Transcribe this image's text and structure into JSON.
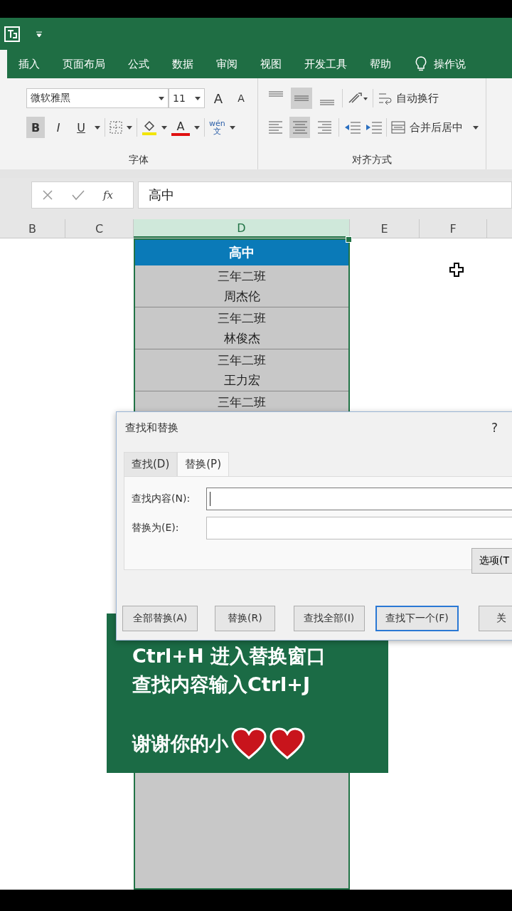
{
  "ribbon_tabs": [
    {
      "label": "插入",
      "selected": false
    },
    {
      "label": "页面布局",
      "selected": false
    },
    {
      "label": "公式",
      "selected": false
    },
    {
      "label": "数据",
      "selected": false
    },
    {
      "label": "审阅",
      "selected": false
    },
    {
      "label": "视图",
      "selected": false
    },
    {
      "label": "开发工具",
      "selected": false
    },
    {
      "label": "帮助",
      "selected": false
    }
  ],
  "tell_me": "操作说",
  "font_group": {
    "font_name": "微软雅黑",
    "font_size": "11",
    "grow_font": "A",
    "shrink_font": "A",
    "style_buttons": [
      {
        "label": "B",
        "selected": true
      },
      {
        "label": "I",
        "selected": false
      },
      {
        "label": "U",
        "selected": false
      }
    ],
    "font_color": "A",
    "phonetic": "wén",
    "phonetic_char": "文",
    "label": "字体"
  },
  "alignment_group": {
    "align_buttons": [
      {
        "kind": "top",
        "selected": false
      },
      {
        "kind": "middle",
        "selected": true
      },
      {
        "kind": "bottom",
        "selected": false
      },
      {
        "kind": "left",
        "selected": false
      },
      {
        "kind": "center",
        "selected": true
      },
      {
        "kind": "right",
        "selected": false
      }
    ],
    "wrap_text": "自动换行",
    "merge_center": "合并后居中",
    "label": "对齐方式"
  },
  "formula_bar": {
    "function_label": "fx",
    "value": "高中"
  },
  "columns": [
    {
      "label": "B",
      "selected": false
    },
    {
      "label": "C",
      "selected": false
    },
    {
      "label": "D",
      "selected": true
    },
    {
      "label": "E",
      "selected": false
    },
    {
      "label": "F",
      "selected": false
    }
  ],
  "cells": {
    "header": "高中",
    "groups": [
      [
        "三年二班",
        "周杰伦"
      ],
      [
        "三年二班",
        "林俊杰"
      ],
      [
        "三年二班",
        "王力宏"
      ],
      [
        "三年二班"
      ]
    ]
  },
  "dialog": {
    "title": "查找和替换",
    "help": "?",
    "tabs": [
      {
        "label": "查找(D)",
        "selected": false
      },
      {
        "label": "替换(P)",
        "selected": true
      }
    ],
    "fields": [
      {
        "label": "查找内容(N):",
        "focused": true
      },
      {
        "label": "替换为(E):",
        "focused": false
      }
    ],
    "options_button": "选项(T",
    "buttons": [
      {
        "label": "全部替换(A)",
        "default": false
      },
      {
        "label": "替换(R)",
        "default": false
      },
      {
        "label": "查找全部(I)",
        "default": false
      },
      {
        "label": "查找下一个(F)",
        "default": true
      },
      {
        "label": "关",
        "default": false
      }
    ]
  },
  "caption": {
    "lines": [
      "Ctrl+H 进入替换窗口",
      "查找内容输入Ctrl+J"
    ],
    "closing": "谢谢你的小",
    "symbols": [
      {
        "kind": "heart"
      },
      {
        "kind": "heart"
      }
    ]
  }
}
